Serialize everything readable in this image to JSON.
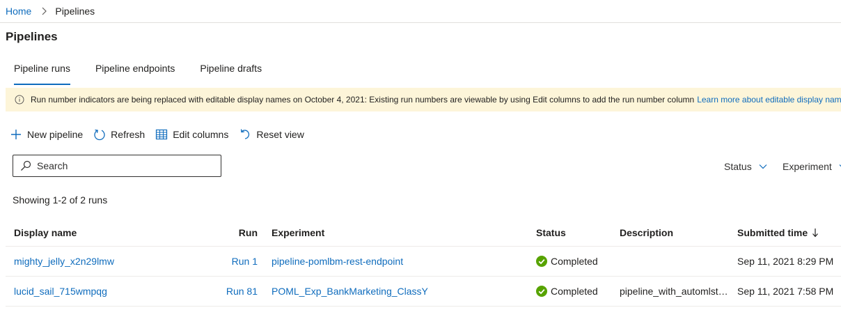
{
  "breadcrumb": {
    "home": "Home",
    "current": "Pipelines"
  },
  "page": {
    "title": "Pipelines"
  },
  "tabs": [
    {
      "label": "Pipeline runs",
      "active": true
    },
    {
      "label": "Pipeline endpoints",
      "active": false
    },
    {
      "label": "Pipeline drafts",
      "active": false
    }
  ],
  "banner": {
    "text": "Run number indicators are being replaced with editable display names on October 4, 2021: Existing run numbers are viewable by using Edit columns to add the run number column",
    "link": "Learn more about editable display names",
    "icon": "info-icon"
  },
  "toolbar": {
    "new_pipeline": "New pipeline",
    "refresh": "Refresh",
    "edit_columns": "Edit columns",
    "reset_view": "Reset view"
  },
  "search": {
    "placeholder": "Search"
  },
  "filters": {
    "status": "Status",
    "experiment": "Experiment"
  },
  "summary": {
    "showing": "Showing 1-2 of 2 runs"
  },
  "table": {
    "columns": {
      "display_name": "Display name",
      "run": "Run",
      "experiment": "Experiment",
      "status": "Status",
      "description": "Description",
      "submitted_time": "Submitted time"
    },
    "rows": [
      {
        "display_name": "mighty_jelly_x2n29lmw",
        "run": "Run 1",
        "experiment": "pipeline-pomlbm-rest-endpoint",
        "status": "Completed",
        "description": "",
        "submitted_time": "Sep 11, 2021 8:29 PM"
      },
      {
        "display_name": "lucid_sail_715wmpqg",
        "run": "Run 81",
        "experiment": "POML_Exp_BankMarketing_ClassY",
        "status": "Completed",
        "description": "pipeline_with_automlst…",
        "submitted_time": "Sep 11, 2021 7:58 PM"
      }
    ]
  },
  "colors": {
    "accent": "#0f6cbd",
    "banner_bg": "#fdf5d9",
    "success": "#57a300"
  }
}
